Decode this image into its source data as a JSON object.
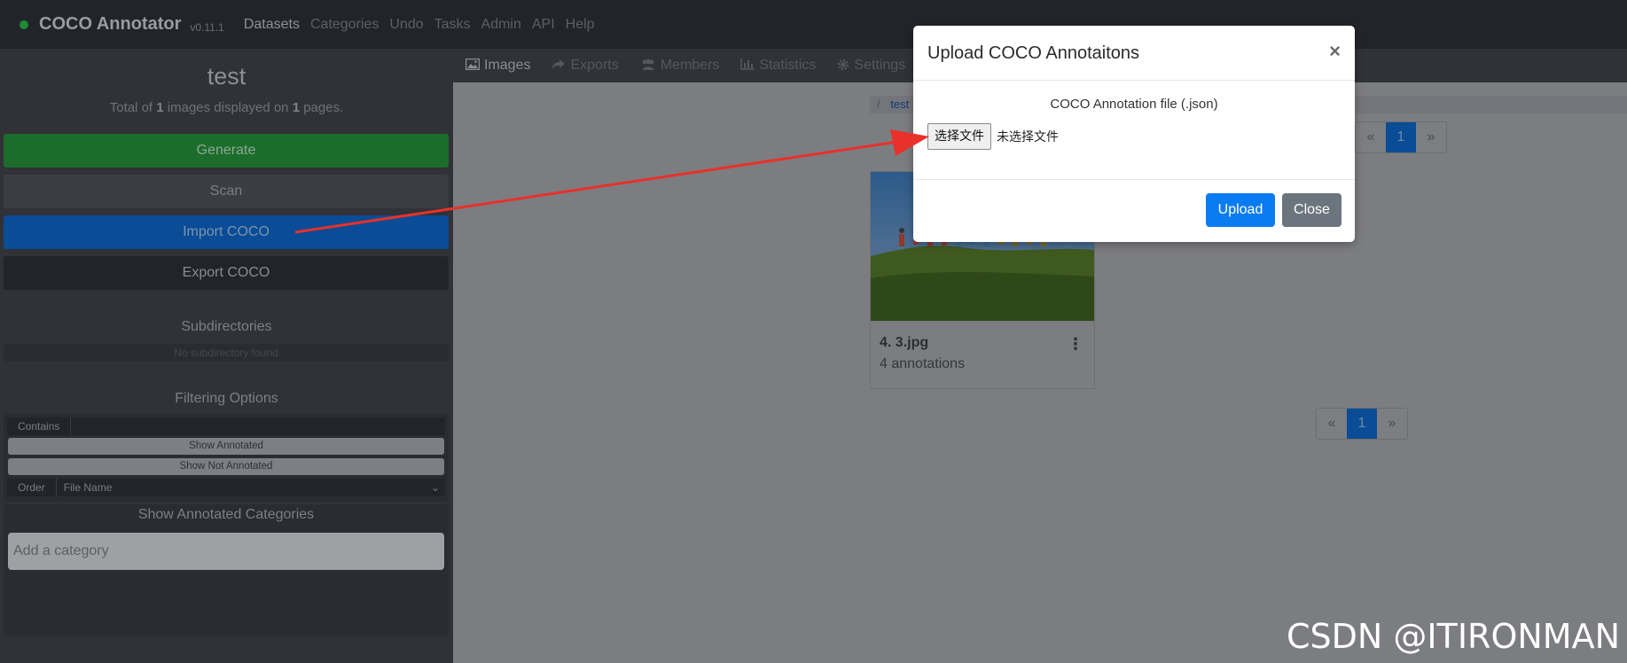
{
  "navbar": {
    "brand": "COCO Annotator",
    "version": "v0.11.1",
    "links": [
      "Datasets",
      "Categories",
      "Undo",
      "Tasks",
      "Admin",
      "API",
      "Help"
    ]
  },
  "sidebar": {
    "dataset_title": "test",
    "summary": {
      "prefix": "Total of ",
      "images": "1",
      "middle": " images displayed on ",
      "pages": "1",
      "suffix": " pages."
    },
    "buttons": {
      "generate": "Generate",
      "scan": "Scan",
      "import": "Import COCO",
      "export": "Export COCO"
    },
    "subdirectories": {
      "heading": "Subdirectories",
      "empty_text": "No subdirectory found"
    },
    "filtering": {
      "heading": "Filtering Options",
      "contains_label": "Contains",
      "show_annotated": "Show Annotated",
      "show_not_annotated": "Show Not Annotated",
      "order_label": "Order",
      "order_value": "File Name"
    },
    "categories": {
      "heading": "Show Annotated Categories",
      "placeholder": "Add a category"
    }
  },
  "main": {
    "tabs": [
      {
        "label": "Images",
        "icon": "image-icon"
      },
      {
        "label": "Exports",
        "icon": "share-icon"
      },
      {
        "label": "Members",
        "icon": "users-icon"
      },
      {
        "label": "Statistics",
        "icon": "bar-chart-icon"
      },
      {
        "label": "Settings",
        "icon": "gear-icon"
      }
    ],
    "breadcrumb": {
      "separator": "/",
      "item": "test"
    },
    "pagination": {
      "prev": "«",
      "current": "1",
      "next": "»"
    },
    "card": {
      "file_name": "4. 3.jpg",
      "annotations": "4 annotations"
    }
  },
  "modal": {
    "title": "Upload COCO Annotaitons",
    "close_symbol": "×",
    "file_label": "COCO Annotation file (.json)",
    "file_button": "选择文件",
    "file_status": "未选择文件",
    "upload_button": "Upload",
    "close_button": "Close"
  },
  "watermark": "CSDN @ITIRONMAN",
  "colors": {
    "arrow": "#e8312a",
    "primary": "#0b7bf2",
    "secondary": "#6c757d"
  }
}
